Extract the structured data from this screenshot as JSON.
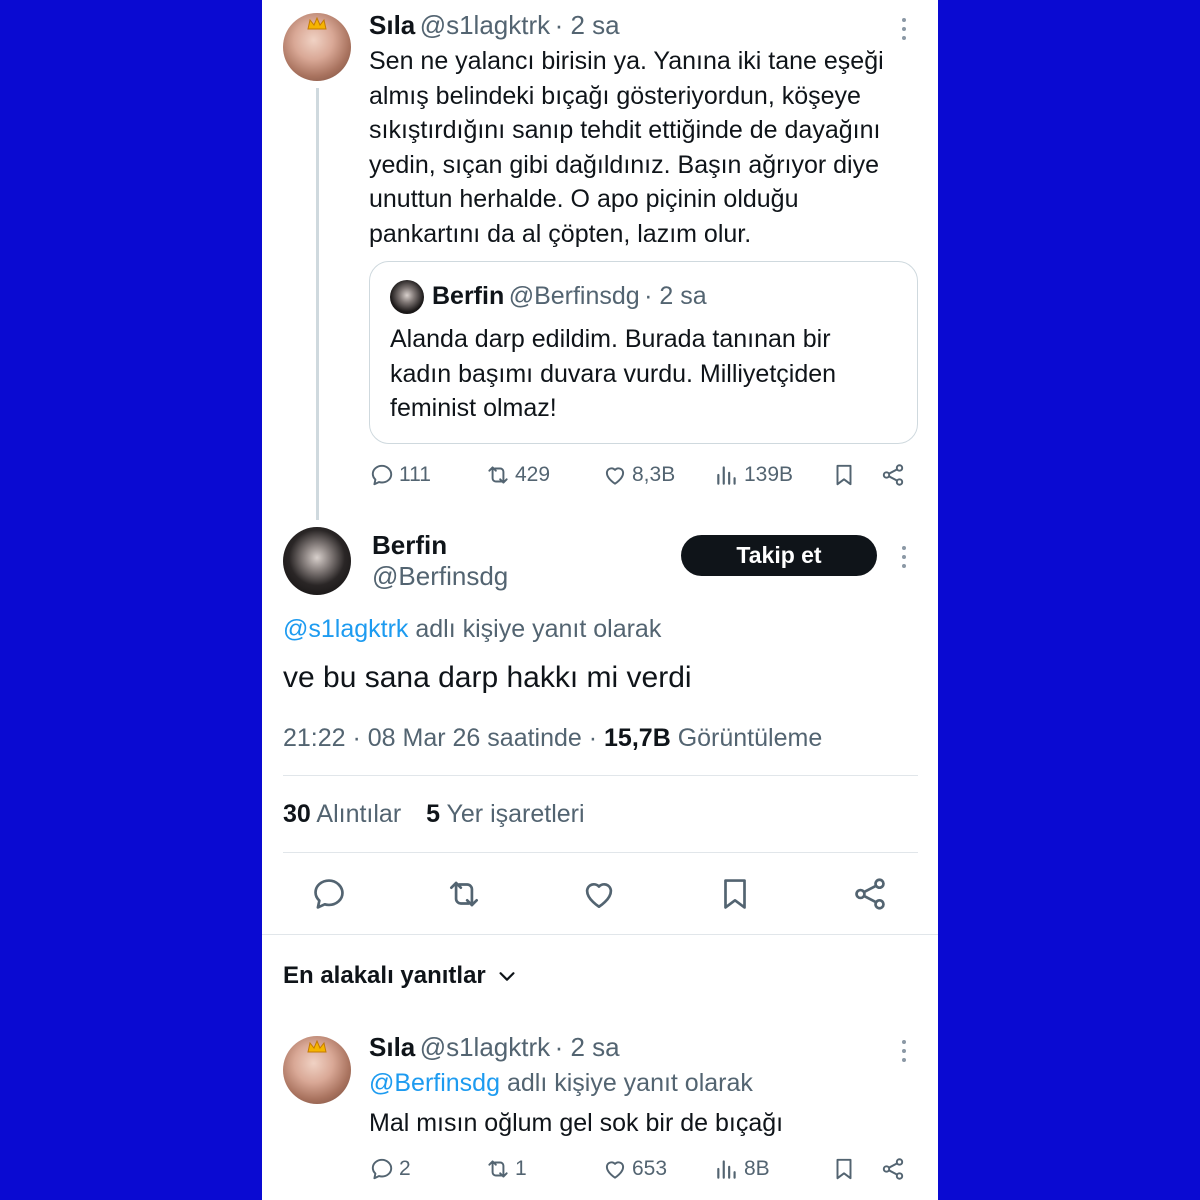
{
  "tweet1": {
    "name": "Sıla",
    "handle": "@s1lagktrk",
    "time": "· 2 sa",
    "lines": [
      "Sen ne yalancı birisin ya. Yanına iki tane eşeği",
      "almış belindeki bıçağı gösteriyordun, köşeye",
      "sıkıştırdığını sanıp tehdit ettiğinde de dayağını",
      "yedin, sıçan gibi dağıldınız. Başın ağrıyor diye",
      "unuttun herhalde. O apo piçinin olduğu",
      "pankartını da al çöpten, lazım olur."
    ],
    "quote": {
      "name": "Berfin",
      "handle": "@Berfinsdg",
      "time": "· 2 sa",
      "lines": [
        "Alanda darp edildim. Burada tanınan bir",
        "kadın başımı duvara vurdu. Milliyetçiden",
        "feminist olmaz!"
      ]
    },
    "actions": {
      "replies": "111",
      "reposts": "429",
      "likes": "8,3B",
      "views": "139B"
    }
  },
  "main": {
    "name": "Berfin",
    "handle": "@Berfinsdg",
    "follow_label": "Takip et",
    "reply_to_handle": "@s1lagktrk",
    "reply_to_suffix": "adlı kişiye yanıt olarak",
    "text": "ve bu sana darp hakkı mi verdi",
    "timestamp": "21:22 · 08 Mar 26 saatinde ·",
    "views_count": "15,7B",
    "views_label": "Görüntüleme",
    "quotes_count": "30",
    "quotes_label": "Alıntılar",
    "bookmarks_count": "5",
    "bookmarks_label": "Yer işaretleri"
  },
  "replies_header": "En alakalı yanıtlar",
  "reply": {
    "name": "Sıla",
    "handle": "@s1lagktrk",
    "time": "· 2 sa",
    "reply_to_handle": "@Berfinsdg",
    "reply_to_suffix": "adlı kişiye yanıt olarak",
    "text": "Mal mısın oğlum gel sok bir de bıçağı",
    "actions": {
      "replies": "2",
      "reposts": "1",
      "likes": "653",
      "views": "8B"
    }
  },
  "icons": [
    "reply-icon",
    "repost-icon",
    "like-icon",
    "views-icon",
    "bookmark-icon",
    "share-icon",
    "chevron-down-icon",
    "more-icon"
  ],
  "colors": {
    "background": "#0a0ad2",
    "link": "#1d9bf0",
    "secondary_text": "#536471",
    "button": "#0f1419"
  }
}
